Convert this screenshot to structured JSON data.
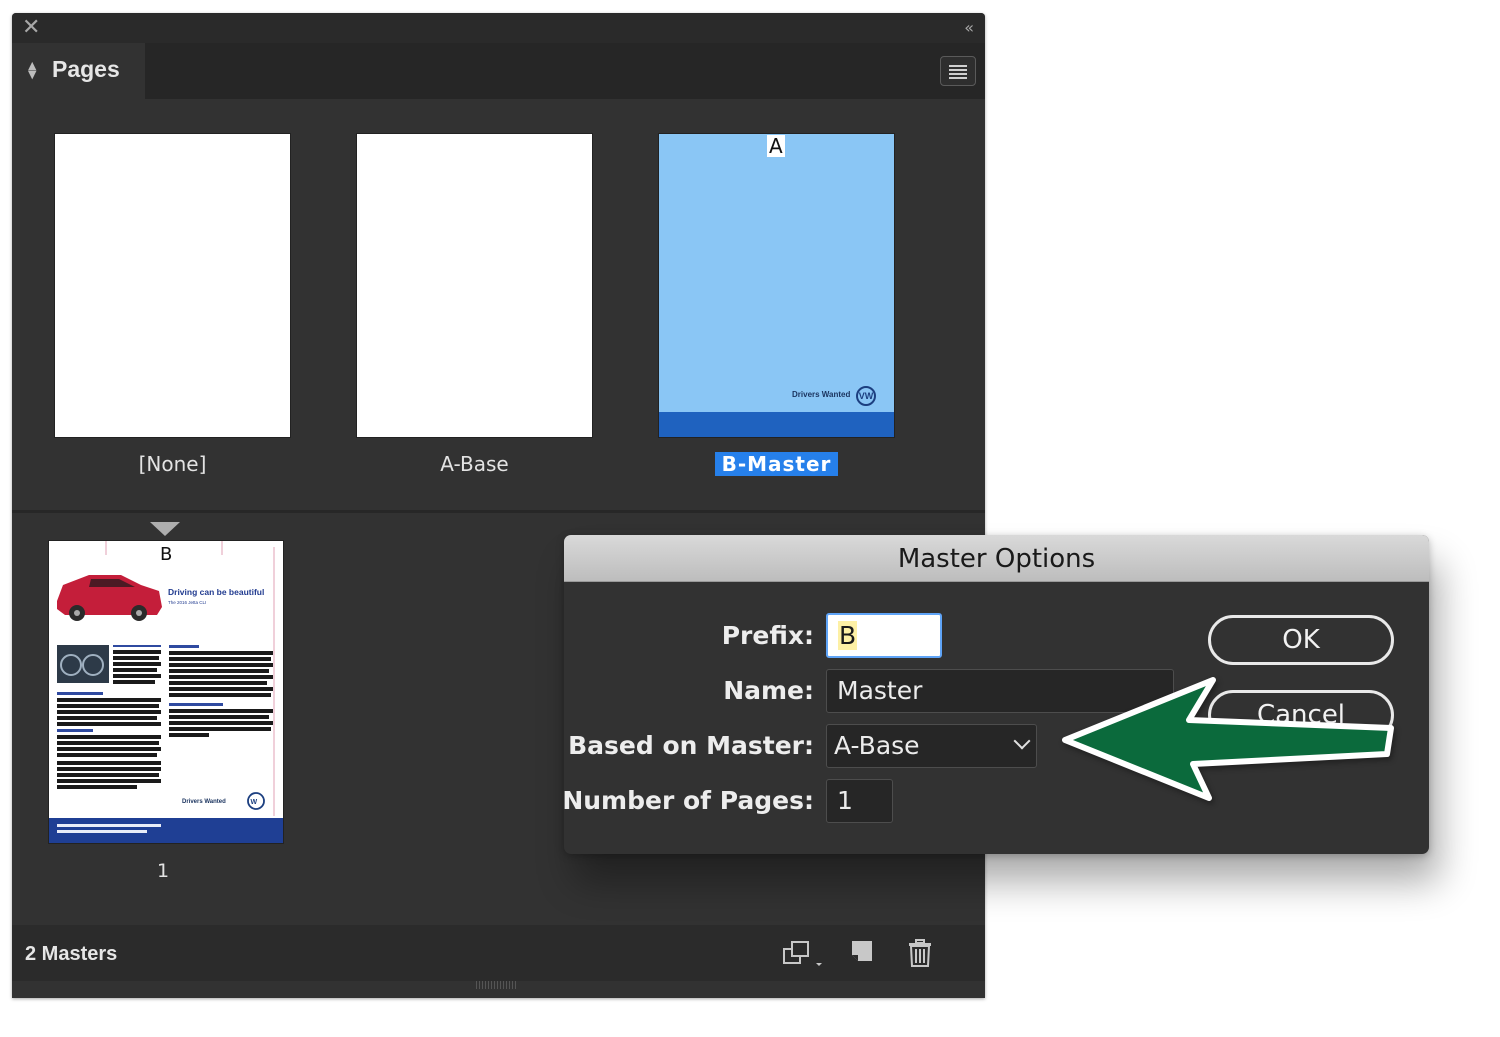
{
  "panel": {
    "title": "Pages",
    "close_icon": "close-icon",
    "collapse_glyph": "‹‹",
    "masters": [
      {
        "label": "[None]"
      },
      {
        "label": "A-Base"
      },
      {
        "label": "B-Master",
        "prefix": "A",
        "brand_text": "Drivers Wanted",
        "selected": true
      }
    ],
    "document_page": {
      "prefix": "B",
      "number": "1",
      "headline": "Driving can be beautiful",
      "subhead": "The 2016 Jetta CLI",
      "brand_text": "Drivers Wanted"
    },
    "footer": {
      "status": "2 Masters"
    }
  },
  "dialog": {
    "title": "Master Options",
    "prefix_label": "Prefix:",
    "prefix_value": "B",
    "name_label": "Name:",
    "name_value": "Master",
    "based_on_label": "Based on Master:",
    "based_on_value": "A-Base",
    "num_pages_label": "Number of Pages:",
    "num_pages_value": "1",
    "ok_label": "OK",
    "cancel_label": "Cancel"
  },
  "colors": {
    "panel_bg": "#323232",
    "selection_blue": "#2680eb",
    "bmaster_fill": "#8ac6f5",
    "bmaster_band": "#1f62bf",
    "arrow_green": "#0b6a3c"
  }
}
